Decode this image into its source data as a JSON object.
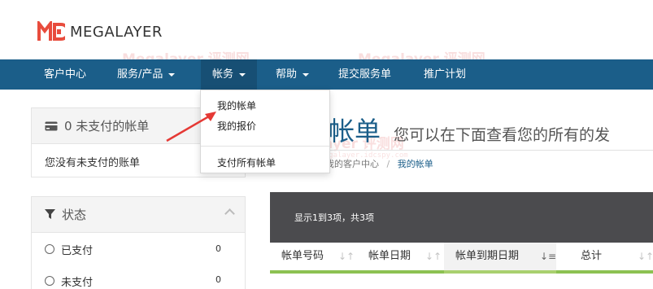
{
  "brand": {
    "name": "MEGALAYER",
    "accent": "#1b5e89",
    "logo_color": "#e84c3d"
  },
  "navbar": {
    "items": [
      {
        "label": "客户中心",
        "has_caret": false
      },
      {
        "label": "服务/产品",
        "has_caret": true
      },
      {
        "label": "帐务",
        "has_caret": true,
        "active": true
      },
      {
        "label": "帮助",
        "has_caret": true
      },
      {
        "label": "提交服务单",
        "has_caret": false
      },
      {
        "label": "推广计划",
        "has_caret": false
      }
    ]
  },
  "dropdown": {
    "items": [
      "我的帐单",
      "我的报价",
      "支付所有帐单"
    ]
  },
  "unpaid_panel": {
    "title": "0 未支付的帐单",
    "body": "您没有未支付的账单"
  },
  "status_panel": {
    "title": "状态",
    "options": [
      {
        "label": "已支付",
        "count": "0"
      },
      {
        "label": "未支付",
        "count": "0"
      }
    ]
  },
  "page": {
    "title": "帐单",
    "subtitle": "您可以在下面查看您的所有的发",
    "breadcrumb": {
      "parent": "我的客户中心",
      "separator": "/",
      "current": "我的帐单"
    }
  },
  "table": {
    "info": "显示1到3项，共3项",
    "columns": [
      "帐单号码",
      "帐单日期",
      "帐单到期日期",
      "总计"
    ]
  },
  "watermark": {
    "text": "Megalayer 评测网",
    "url": "https://megalayer.idcspy.com"
  }
}
